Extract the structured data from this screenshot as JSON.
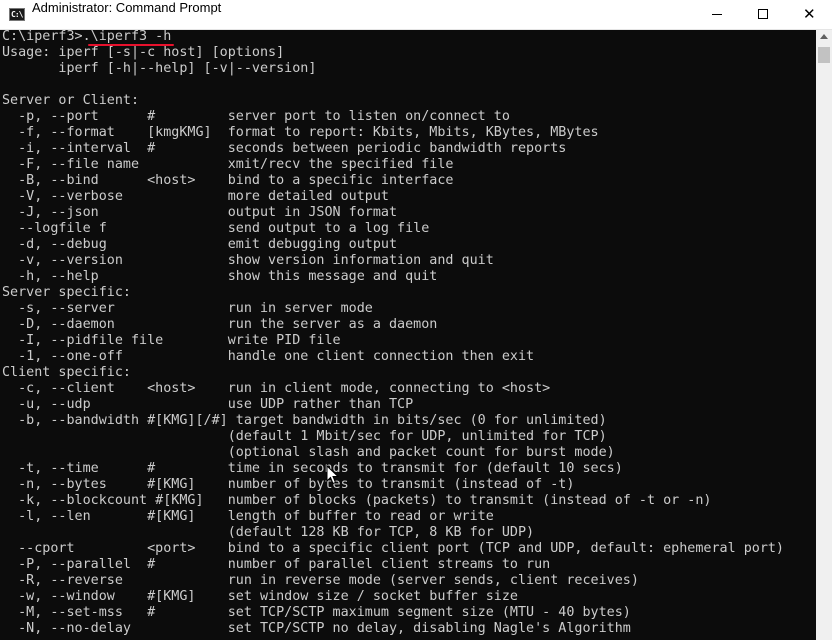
{
  "window": {
    "title": "Administrator: Command Prompt",
    "icon_name": "cmd-icon",
    "icon_text": "C:\\",
    "buttons": [
      "minimize-icon",
      "maximize-icon",
      "close-icon"
    ]
  },
  "console": {
    "background": "#0c0c0c",
    "foreground": "#cccccc",
    "annotation_color": "#e8112d",
    "lines": [
      "C:\\iperf3>.\\iperf3 -h",
      "Usage: iperf [-s|-c host] [options]",
      "       iperf [-h|--help] [-v|--version]",
      "",
      "Server or Client:",
      "  -p, --port      #         server port to listen on/connect to",
      "  -f, --format    [kmgKMG]  format to report: Kbits, Mbits, KBytes, MBytes",
      "  -i, --interval  #         seconds between periodic bandwidth reports",
      "  -F, --file name           xmit/recv the specified file",
      "  -B, --bind      <host>    bind to a specific interface",
      "  -V, --verbose             more detailed output",
      "  -J, --json                output in JSON format",
      "  --logfile f               send output to a log file",
      "  -d, --debug               emit debugging output",
      "  -v, --version             show version information and quit",
      "  -h, --help                show this message and quit",
      "Server specific:",
      "  -s, --server              run in server mode",
      "  -D, --daemon              run the server as a daemon",
      "  -I, --pidfile file        write PID file",
      "  -1, --one-off             handle one client connection then exit",
      "Client specific:",
      "  -c, --client    <host>    run in client mode, connecting to <host>",
      "  -u, --udp                 use UDP rather than TCP",
      "  -b, --bandwidth #[KMG][/#] target bandwidth in bits/sec (0 for unlimited)",
      "                            (default 1 Mbit/sec for UDP, unlimited for TCP)",
      "                            (optional slash and packet count for burst mode)",
      "  -t, --time      #         time in seconds to transmit for (default 10 secs)",
      "  -n, --bytes     #[KMG]    number of bytes to transmit (instead of -t)",
      "  -k, --blockcount #[KMG]   number of blocks (packets) to transmit (instead of -t or -n)",
      "  -l, --len       #[KMG]    length of buffer to read or write",
      "                            (default 128 KB for TCP, 8 KB for UDP)",
      "  --cport         <port>    bind to a specific client port (TCP and UDP, default: ephemeral port)",
      "  -P, --parallel  #         number of parallel client streams to run",
      "  -R, --reverse             run in reverse mode (server sends, client receives)",
      "  -w, --window    #[KMG]    set window size / socket buffer size",
      "  -M, --set-mss   #         set TCP/SCTP maximum segment size (MTU - 40 bytes)",
      "  -N, --no-delay            set TCP/SCTP no delay, disabling Nagle's Algorithm"
    ]
  }
}
